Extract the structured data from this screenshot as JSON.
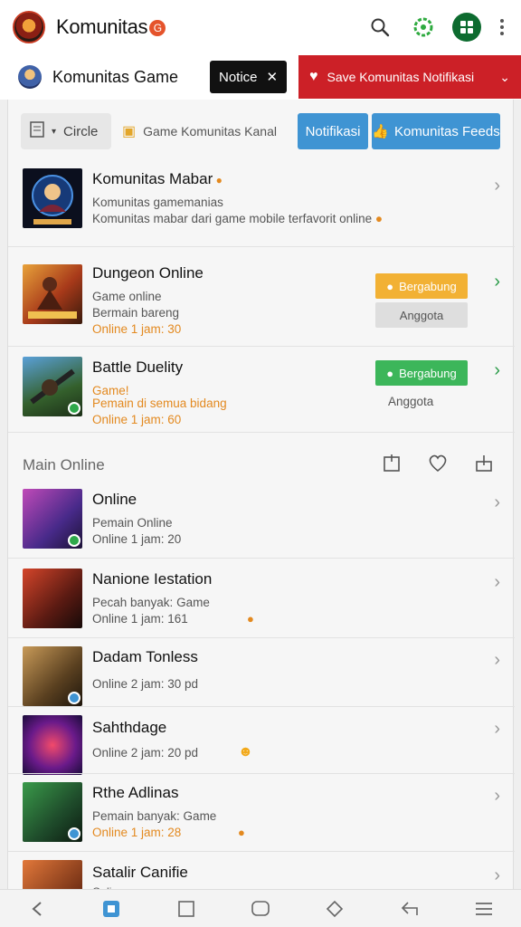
{
  "header": {
    "title": "Komunitas",
    "badge": "G"
  },
  "tabs": {
    "community_label": "Komunitas   Game",
    "notice_label": "Notice",
    "banner_label": "Save Komunitas Notifikasi"
  },
  "filters": {
    "sort_label": "Circle",
    "search_hint": "Game Komunitas Kanal",
    "blue_btn_1": "Notifikasi",
    "blue_btn_2": "Komunitas Feeds"
  },
  "featured": {
    "title": "Komunitas Mabar",
    "line1": "Komunitas gamemanias",
    "line2": "Komunitas mabar dari game mobile terfavorit online"
  },
  "game_rows": [
    {
      "title": "Dungeon Online",
      "line1": "Game online",
      "line2": "Bermain bareng",
      "line3": "Online 1 jam: 30",
      "btn_primary": "Bergabung",
      "btn_secondary": "Anggota",
      "primary_color": "#f2b134"
    },
    {
      "title": "Battle Duelity",
      "line1": "Game!",
      "line2": "Pemain di semua bidang",
      "line3": "Online 1 jam: 60",
      "btn_primary": "Bergabung",
      "btn_secondary": "Anggota",
      "primary_color": "#3cb65a"
    }
  ],
  "section": {
    "title": "Main Online"
  },
  "online_list": [
    {
      "title": "Online",
      "line1": "Pemain Online",
      "line2": "Online 1 jam: 20",
      "accent": ""
    },
    {
      "title": "Nanione Iestation",
      "line1": "Pecah banyak: Game",
      "line2": "Online 1 jam: 161",
      "accent": ""
    },
    {
      "title": "Dadam Tonless",
      "line1": "Online 2 jam: 30 pd",
      "line2": "",
      "accent": ""
    },
    {
      "title": "Sahthdage",
      "line1": "Online 2 jam: 20 pd",
      "line2": "",
      "accent": ""
    },
    {
      "title": "Rthe Adlinas",
      "line1": "Pemain banyak: Game",
      "line2": "Online 1 jam: 28",
      "accent": ""
    },
    {
      "title": "Satalir Canifie",
      "line1": "Online",
      "line2": "",
      "accent": ""
    }
  ],
  "colors": {
    "red_banner": "#cc2027",
    "blue_btn": "#3f94d3",
    "green_dark": "#0d6b2f",
    "orange_text": "#e3891f"
  }
}
